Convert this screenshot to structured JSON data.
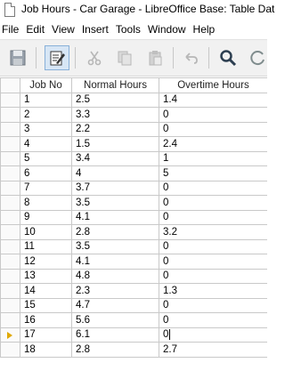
{
  "window": {
    "title": "Job Hours - Car Garage - LibreOffice Base: Table Dat"
  },
  "menubar": {
    "items": [
      "File",
      "Edit",
      "View",
      "Insert",
      "Tools",
      "Window",
      "Help"
    ]
  },
  "toolbar": {
    "buttons": [
      "save-icon",
      "edit-mode-icon",
      "cut-icon",
      "copy-icon",
      "paste-icon",
      "undo-icon",
      "find-icon",
      "refresh-icon"
    ]
  },
  "table": {
    "columns": [
      "Job No",
      "Normal Hours",
      "Overtime Hours"
    ],
    "rows": [
      [
        "1",
        "2.5",
        "1.4"
      ],
      [
        "2",
        "3.3",
        "0"
      ],
      [
        "3",
        "2.2",
        "0"
      ],
      [
        "4",
        "1.5",
        "2.4"
      ],
      [
        "5",
        "3.4",
        "1"
      ],
      [
        "6",
        "4",
        "5"
      ],
      [
        "7",
        "3.7",
        "0"
      ],
      [
        "8",
        "3.5",
        "0"
      ],
      [
        "9",
        "4.1",
        "0"
      ],
      [
        "10",
        "2.8",
        "3.2"
      ],
      [
        "11",
        "3.5",
        "0"
      ],
      [
        "12",
        "4.1",
        "0"
      ],
      [
        "13",
        "4.8",
        "0"
      ],
      [
        "14",
        "2.3",
        "1.3"
      ],
      [
        "15",
        "4.7",
        "0"
      ],
      [
        "16",
        "5.6",
        "0"
      ],
      [
        "17",
        "6.1",
        "0"
      ],
      [
        "18",
        "2.8",
        "2.7"
      ]
    ],
    "current_row": 17
  }
}
